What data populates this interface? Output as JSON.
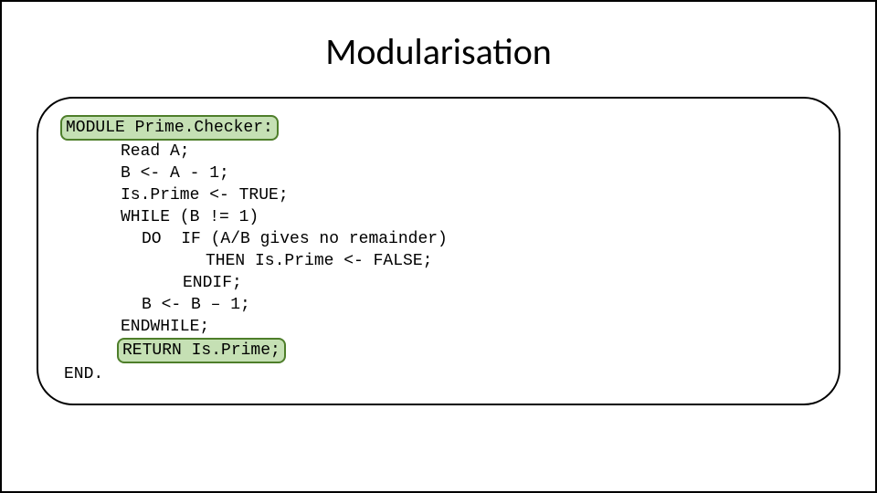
{
  "slide": {
    "title": "Modularisation",
    "code": {
      "l0": "MODULE Prime.Checker:",
      "l1": "Read A;",
      "l2": "B <- A - 1;",
      "l3": "Is.Prime <- TRUE;",
      "l4": "WHILE (B != 1)",
      "l5": "DO  IF (A/B gives no remainder)",
      "l6": "THEN Is.Prime <- FALSE;",
      "l7": "ENDIF;",
      "l8": "B <- B – 1;",
      "l9": "ENDWHILE;",
      "l10": "RETURN Is.Prime;",
      "l11": "END."
    }
  }
}
